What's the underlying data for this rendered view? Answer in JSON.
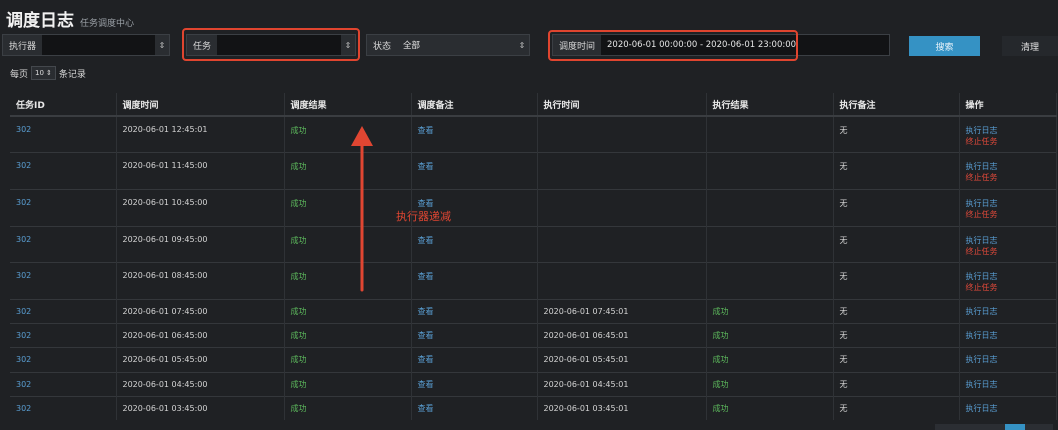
{
  "header": {
    "title": "调度日志",
    "subtitle": "任务调度中心"
  },
  "filters": {
    "executor_label": "执行器",
    "executor_value": "",
    "task_label": "任务",
    "task_value": "",
    "status_label": "状态",
    "status_value": "全部",
    "time_label": "调度时间",
    "time_value": "2020-06-01 00:00:00 - 2020-06-01 23:00:00",
    "search_label": "搜索",
    "clear_label": "清理"
  },
  "page_size": {
    "prefix": "每页",
    "value": "10",
    "suffix": "条记录"
  },
  "table": {
    "columns": [
      "任务ID",
      "调度时间",
      "调度结果",
      "调度备注",
      "执行时间",
      "执行结果",
      "执行备注",
      "操作"
    ],
    "rows": [
      {
        "id": "302",
        "trigger_time": "2020-06-01 12:45:01",
        "trigger_result": "成功",
        "trigger_note": "查看",
        "exec_time": "",
        "exec_result": "",
        "exec_note": "无",
        "log": "执行日志",
        "kill": "终止任务"
      },
      {
        "id": "302",
        "trigger_time": "2020-06-01 11:45:00",
        "trigger_result": "成功",
        "trigger_note": "查看",
        "exec_time": "",
        "exec_result": "",
        "exec_note": "无",
        "log": "执行日志",
        "kill": "终止任务"
      },
      {
        "id": "302",
        "trigger_time": "2020-06-01 10:45:00",
        "trigger_result": "成功",
        "trigger_note": "查看",
        "exec_time": "",
        "exec_result": "",
        "exec_note": "无",
        "log": "执行日志",
        "kill": "终止任务"
      },
      {
        "id": "302",
        "trigger_time": "2020-06-01 09:45:00",
        "trigger_result": "成功",
        "trigger_note": "查看",
        "exec_time": "",
        "exec_result": "",
        "exec_note": "无",
        "log": "执行日志",
        "kill": "终止任务"
      },
      {
        "id": "302",
        "trigger_time": "2020-06-01 08:45:00",
        "trigger_result": "成功",
        "trigger_note": "查看",
        "exec_time": "",
        "exec_result": "",
        "exec_note": "无",
        "log": "执行日志",
        "kill": "终止任务"
      },
      {
        "id": "302",
        "trigger_time": "2020-06-01 07:45:00",
        "trigger_result": "成功",
        "trigger_note": "查看",
        "exec_time": "2020-06-01 07:45:01",
        "exec_result": "成功",
        "exec_note": "无",
        "log": "执行日志",
        "kill": ""
      },
      {
        "id": "302",
        "trigger_time": "2020-06-01 06:45:00",
        "trigger_result": "成功",
        "trigger_note": "查看",
        "exec_time": "2020-06-01 06:45:01",
        "exec_result": "成功",
        "exec_note": "无",
        "log": "执行日志",
        "kill": ""
      },
      {
        "id": "302",
        "trigger_time": "2020-06-01 05:45:00",
        "trigger_result": "成功",
        "trigger_note": "查看",
        "exec_time": "2020-06-01 05:45:01",
        "exec_result": "成功",
        "exec_note": "无",
        "log": "执行日志",
        "kill": ""
      },
      {
        "id": "302",
        "trigger_time": "2020-06-01 04:45:00",
        "trigger_result": "成功",
        "trigger_note": "查看",
        "exec_time": "2020-06-01 04:45:01",
        "exec_result": "成功",
        "exec_note": "无",
        "log": "执行日志",
        "kill": ""
      },
      {
        "id": "302",
        "trigger_time": "2020-06-01 03:45:00",
        "trigger_result": "成功",
        "trigger_note": "查看",
        "exec_time": "2020-06-01 03:45:01",
        "exec_result": "成功",
        "exec_note": "无",
        "log": "执行日志",
        "kill": ""
      }
    ]
  },
  "annotation": {
    "text": "执行器递减"
  },
  "colors": {
    "accent": "#3592c4",
    "success": "#5cb85c",
    "danger": "#e0493a",
    "link": "#5a9fd4",
    "annotation": "#e04632"
  }
}
